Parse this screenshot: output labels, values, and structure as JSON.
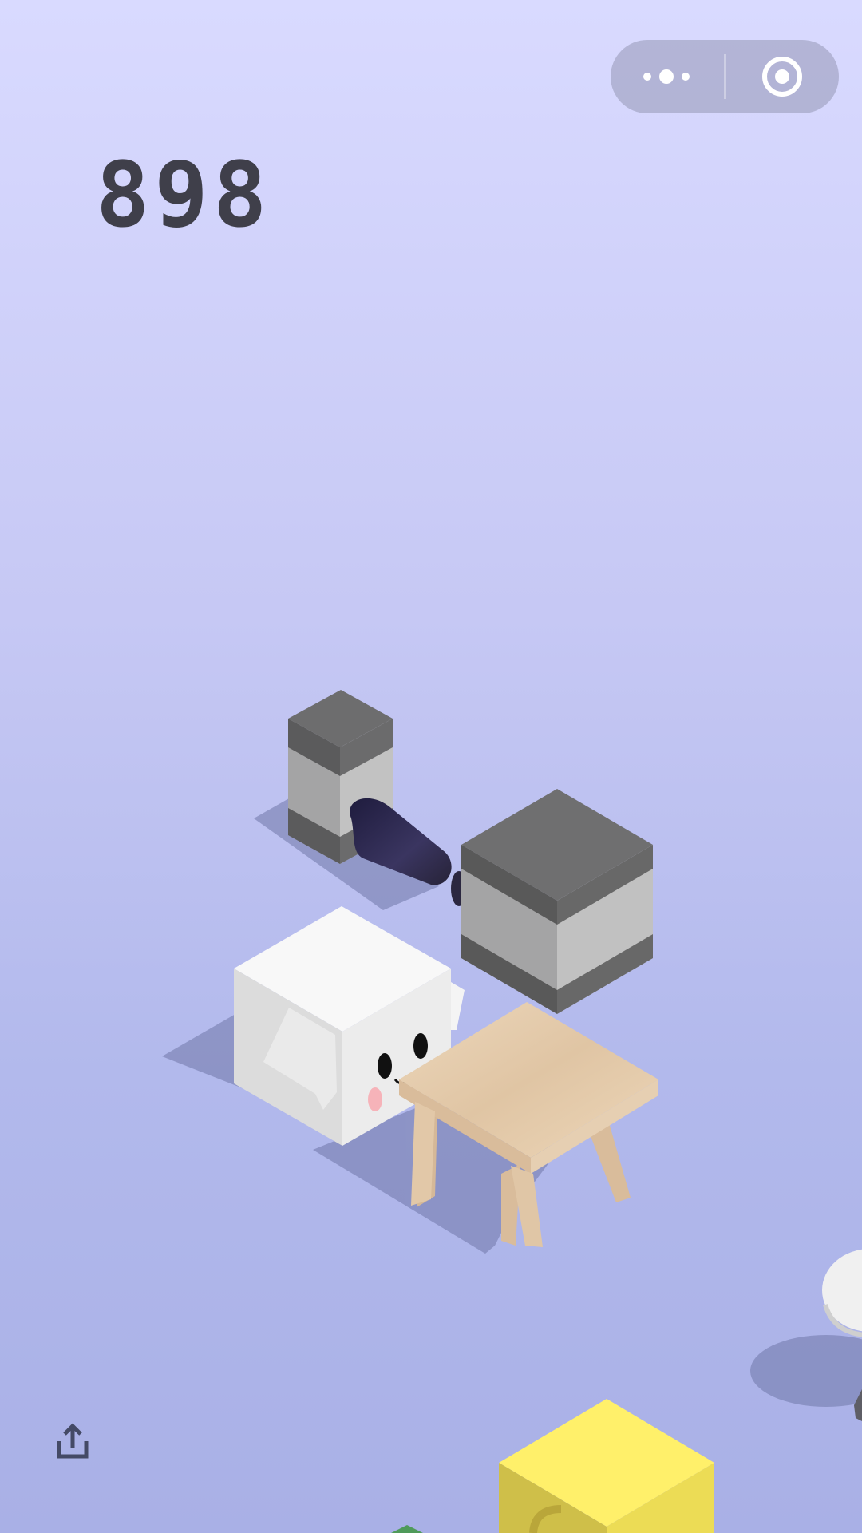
{
  "game": {
    "score": "898"
  },
  "hud": {
    "capsule": {
      "more_icon": "more-dots-icon",
      "close_icon": "target-close-icon"
    },
    "share_icon": "share-upload-icon"
  },
  "colors": {
    "sky_top": "#d9daff",
    "sky_bottom": "#a9b0e6",
    "score_color": "#3f3f4a",
    "block_gray_top": "#6f6f70",
    "block_gray_band": "#c1c1c1",
    "player_white": "#f7f7f7",
    "stool_wood": "#e5cdb0",
    "next_yellow": "#fff06a"
  }
}
